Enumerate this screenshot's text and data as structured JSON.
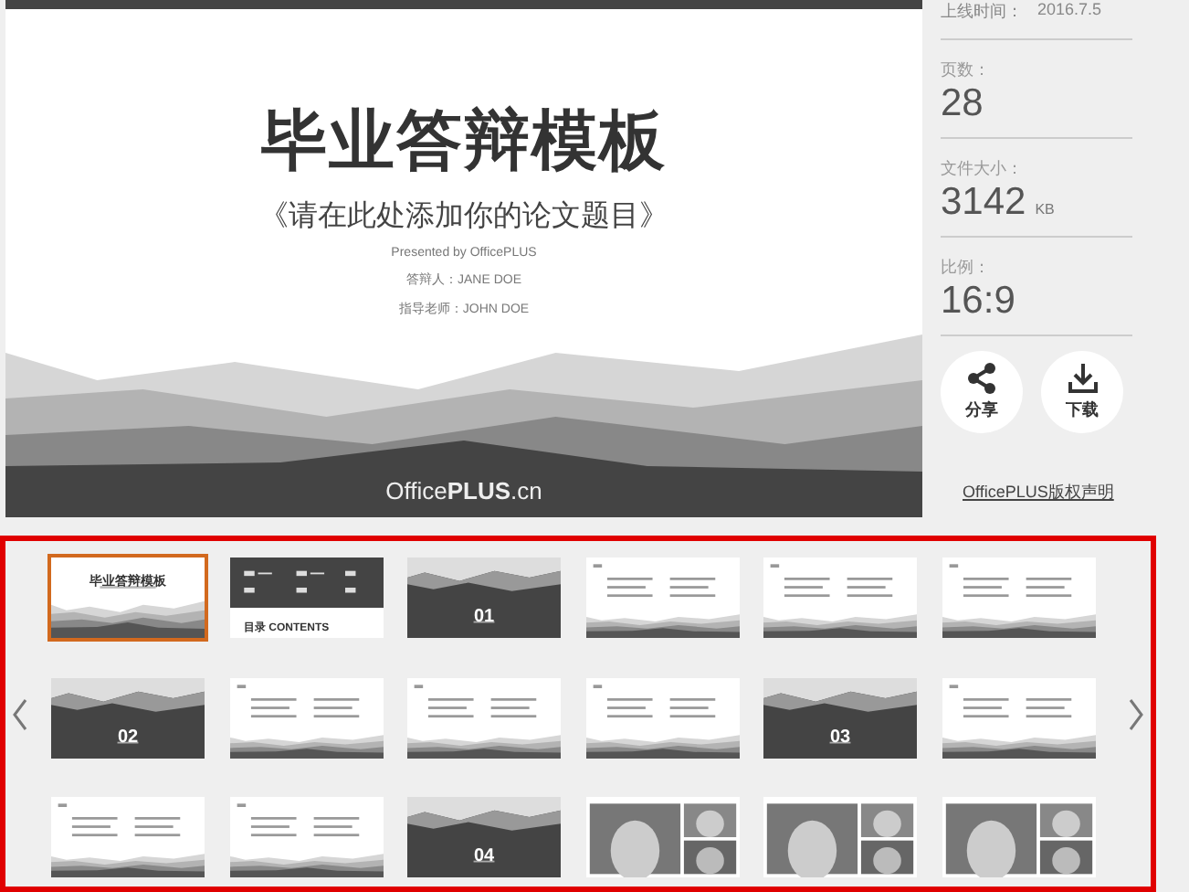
{
  "slide": {
    "title": "毕业答辩模板",
    "subtitle": "《请在此处添加你的论文题目》",
    "credits": [
      "Presented by OfficePLUS",
      "答辩人：JANE DOE",
      "指导老师：JOHN DOE"
    ],
    "brand": "Office**PLUS**.cn"
  },
  "info": {
    "uploaded": {
      "label": "上线时间：",
      "value": "2016.7.5"
    },
    "stats": [
      {
        "label": "页数：",
        "value": "28"
      },
      {
        "label": "文件大小：",
        "value": "3142",
        "unit": "KB"
      },
      {
        "label": "比例：",
        "value": "16:9"
      }
    ]
  },
  "actions": [
    {
      "kind": "share",
      "label": "分享"
    },
    {
      "kind": "download",
      "label": "下载"
    }
  ],
  "copyright_link": "OfficePLUS版权声明",
  "thumbnails": [
    {
      "kind": "title",
      "label": "毕业答辩模板",
      "selected": true
    },
    {
      "kind": "contents",
      "label": "目录 CONTENTS",
      "selected": false
    },
    {
      "kind": "section",
      "label": "01",
      "selected": false
    },
    {
      "kind": "content",
      "selected": false
    },
    {
      "kind": "content",
      "selected": false
    },
    {
      "kind": "content",
      "selected": false
    },
    {
      "kind": "section",
      "label": "02",
      "selected": false
    },
    {
      "kind": "content",
      "selected": false
    },
    {
      "kind": "content",
      "selected": false
    },
    {
      "kind": "content",
      "selected": false
    },
    {
      "kind": "section",
      "label": "03",
      "selected": false
    },
    {
      "kind": "content",
      "selected": false
    },
    {
      "kind": "content",
      "selected": false
    },
    {
      "kind": "content",
      "selected": false
    },
    {
      "kind": "section",
      "label": "04",
      "selected": false
    },
    {
      "kind": "photo",
      "selected": false
    },
    {
      "kind": "photo",
      "selected": false
    },
    {
      "kind": "photo",
      "selected": false
    }
  ]
}
